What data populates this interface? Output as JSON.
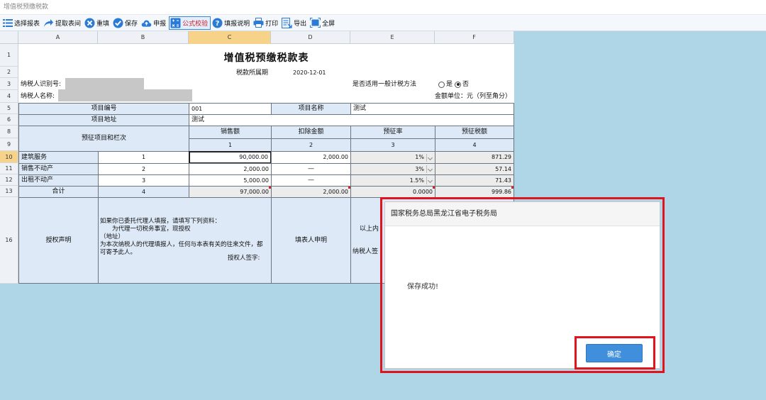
{
  "window": {
    "title": "增值税预缴税款"
  },
  "toolbar": {
    "items": [
      {
        "label": "选择报表",
        "icon": "list-icon"
      },
      {
        "label": "提取表间",
        "icon": "share-arrow-icon"
      },
      {
        "label": "重填",
        "icon": "close-circle-icon"
      },
      {
        "label": "保存",
        "icon": "check-circle-icon"
      },
      {
        "label": "申报",
        "icon": "cloud-upload-icon"
      },
      {
        "label": "公式校验",
        "icon": "formula-icon",
        "active": true
      },
      {
        "label": "填报说明",
        "icon": "help-circle-icon"
      },
      {
        "label": "打印",
        "icon": "printer-icon"
      },
      {
        "label": "导出",
        "icon": "export-icon"
      },
      {
        "label": "全屏",
        "icon": "fullscreen-icon"
      }
    ]
  },
  "sheet": {
    "columns": [
      "A",
      "B",
      "C",
      "D",
      "E",
      "F"
    ],
    "selected_column": "C",
    "rows": [
      "1",
      "2",
      "3",
      "4",
      "5",
      "6",
      "8",
      "9",
      "10",
      "11",
      "12",
      "13",
      "16"
    ],
    "selected_row": "10",
    "title": "增值税预缴税款表",
    "period_label": "税款所属期",
    "period_value": "2020-12-01",
    "taxpayer_id_label": "纳税人识别号:",
    "taxpayer_name_label": "纳税人名称:",
    "general_method_label": "是否适用一般计税方法",
    "radio_yes": "是",
    "radio_no": "否",
    "amount_unit": "金额单位：元（列至角分）",
    "project_code_label": "项目编号",
    "project_code_value": "001",
    "project_name_label": "项目名称",
    "project_name_value": "测试",
    "project_addr_label": "项目地址",
    "project_addr_value": "测试",
    "col_header_item": "预征项目和栏次",
    "col_header_sales": "销售额",
    "col_header_deduct": "扣除金额",
    "col_header_rate": "预征率",
    "col_header_tax": "预征税额",
    "col_num_1": "1",
    "col_num_2": "2",
    "col_num_3": "3",
    "col_num_4": "4",
    "data_rows": [
      {
        "name": "建筑服务",
        "line": "1",
        "sales": "90,000.00",
        "deduct": "2,000.00",
        "rate": "1%",
        "tax": "871.29"
      },
      {
        "name": "销售不动产",
        "line": "2",
        "sales": "2,000.00",
        "deduct": "—",
        "rate": "3%",
        "tax": "57.14"
      },
      {
        "name": "出租不动产",
        "line": "3",
        "sales": "5,000.00",
        "deduct": "—",
        "rate": "1.5%",
        "tax": "71.43"
      }
    ],
    "total_row": {
      "name": "合计",
      "line": "4",
      "sales": "97,000.00",
      "deduct": "2,000.00",
      "rate": "0.0000",
      "tax": "999.86"
    },
    "auth_label": "授权声明",
    "auth_text": "如果你已委托代理人填报，请填写下列资料：\n　　为代理一切税务事宜，现授权\n（地址）\n为本次纳税人的代理填报人，任何与本表有关的往来文件，都可寄予此人。",
    "auth_sign": "授权人签字:",
    "filler_label": "填表人申明",
    "filler_text": "以上内",
    "taxpayer_sign": "纳税人签"
  },
  "dialog": {
    "title": "国家税务总局黑龙江省电子税务局",
    "message": "保存成功!",
    "ok_label": "确定"
  },
  "colors": {
    "accent": "#3f8fdc",
    "highlight": "#e1141d",
    "background": "#aed6e6",
    "header_cell": "#dde9f7"
  }
}
